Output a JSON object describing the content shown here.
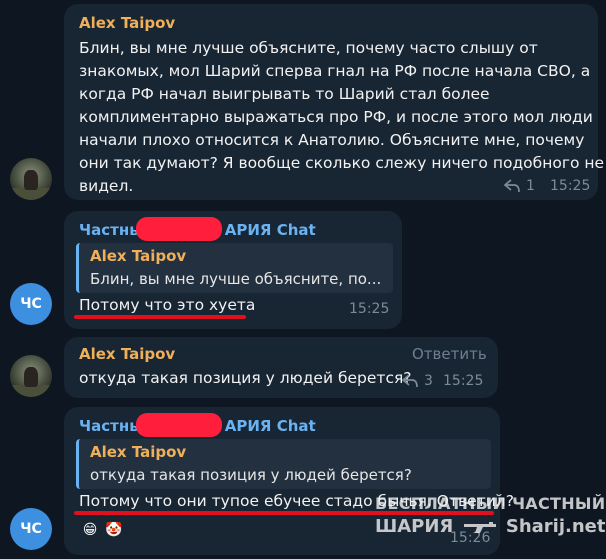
{
  "messages": [
    {
      "sender": "Alex Taipov",
      "text_lines": [
        "Блин, вы мне лучше объясните, почему часто слышу от",
        "знакомых, мол Шарий сперва гнал на РФ после начала СВО, а",
        "когда РФ начал выигрывать то Шарий стал более",
        "комплиментарно выражаться про РФ, и после этого мол люди",
        "начали плохо относится к Анатолию. Объясните мне, почему",
        "они так думают? Я вообще сколько слежу ничего подобного не",
        "видел."
      ],
      "reply_count": "1",
      "time": "15:25"
    },
    {
      "sender_start": "Частны",
      "sender_end": "АРИЯ Chat",
      "avatar": "ЧС",
      "quote_name": "Alex Taipov",
      "quote_text": "Блин, вы мне лучше объясните, по...",
      "text": "Потому что это хуета",
      "time": "15:25"
    },
    {
      "sender": "Alex Taipov",
      "reply_label": "Ответить",
      "text": "откуда такая позиция у людей берется?",
      "reply_count": "3",
      "time": "15:25"
    },
    {
      "sender_start": "Частны",
      "sender_end": "АРИЯ Chat",
      "avatar": "ЧС",
      "quote_name": "Alex Taipov",
      "quote_text": "откуда такая позиция у людей берется?",
      "text": "Потому что они тупое ебучее стадо бычья. Ответил?",
      "time": "15:26",
      "reactions": [
        "😁",
        "🤡"
      ]
    }
  ],
  "watermark": {
    "line1": "БЕСПЛАТНЫЙ ЧАСТНЫЙ",
    "line2_start": "ШАРИЯ",
    "line2_end": "Sharij.net"
  },
  "colors": {
    "background": "#0e1621",
    "bubble": "#182533",
    "sender_orange": "#f0b05a",
    "sender_blue": "#6ab3f3",
    "redaction": "#ff1f3d",
    "underline": "#e0101e",
    "avatar_blue": "#3d8fe0"
  }
}
